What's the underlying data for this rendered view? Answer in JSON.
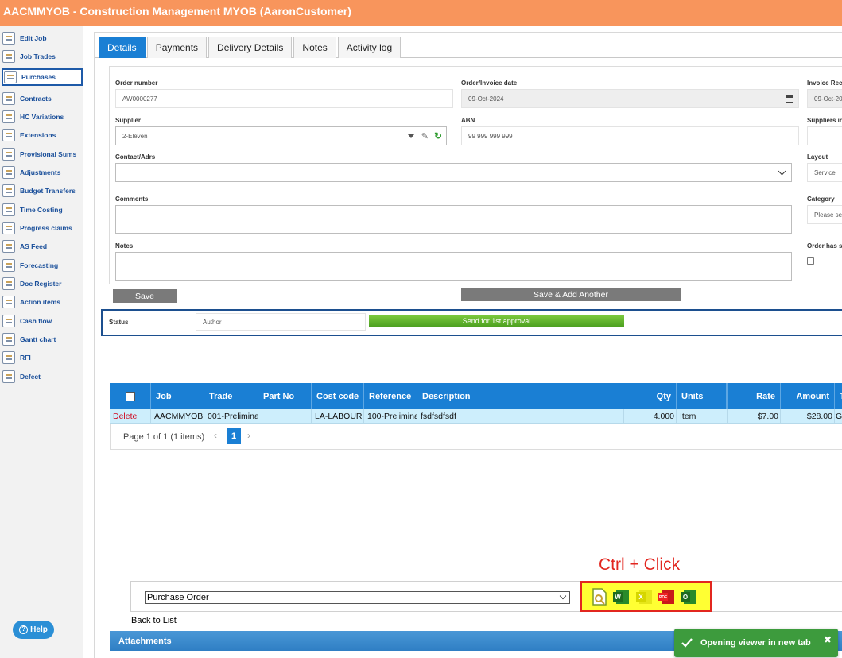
{
  "app": {
    "title": "AACMMYOB - Construction Management MYOB (AaronCustomer)"
  },
  "sidebar": {
    "items": [
      {
        "label": "Edit Job",
        "icon": "edit-icon"
      },
      {
        "label": "Job Trades",
        "icon": "folder-icon"
      },
      {
        "label": "Purchases",
        "icon": "purchases-icon",
        "active": true
      },
      {
        "label": "Contracts",
        "icon": "contract-icon"
      },
      {
        "label": "HC Variations",
        "icon": "variations-icon"
      },
      {
        "label": "Extensions",
        "icon": "extensions-icon"
      },
      {
        "label": "Provisional Sums",
        "icon": "provisional-sums-icon"
      },
      {
        "label": "Adjustments",
        "icon": "adjustments-icon"
      },
      {
        "label": "Budget Transfers",
        "icon": "budget-transfer-icon"
      },
      {
        "label": "Time Costing",
        "icon": "time-costing-icon"
      },
      {
        "label": "Progress claims",
        "icon": "progress-claims-icon"
      },
      {
        "label": "AS Feed",
        "icon": "feed-icon"
      },
      {
        "label": "Forecasting",
        "icon": "forecasting-icon"
      },
      {
        "label": "Doc Register",
        "icon": "doc-register-icon"
      },
      {
        "label": "Action items",
        "icon": "action-items-icon"
      },
      {
        "label": "Cash flow",
        "icon": "cash-flow-icon"
      },
      {
        "label": "Gantt chart",
        "icon": "gantt-icon"
      },
      {
        "label": "RFI",
        "icon": "rfi-icon"
      },
      {
        "label": "Defect",
        "icon": "defect-icon"
      }
    ],
    "help_label": "Help"
  },
  "tabs": [
    {
      "label": "Details",
      "active": true
    },
    {
      "label": "Payments"
    },
    {
      "label": "Delivery Details"
    },
    {
      "label": "Notes"
    },
    {
      "label": "Activity log"
    }
  ],
  "form": {
    "order_number_label": "Order number",
    "order_number_value": "AW0000277",
    "order_date_label": "Order/Invoice date",
    "order_date_value": "09-Oct-2024",
    "invoice_received_label": "Invoice Rece",
    "invoice_received_value": "09-Oct-20",
    "supplier_label": "Supplier",
    "supplier_value": "2-Eleven",
    "abn_label": "ABN",
    "abn_value": "99 999 999 999",
    "suppliers_inv_label": "Suppliers in",
    "contact_label": "Contact/Adrs",
    "layout_label": "Layout",
    "layout_value": "Service",
    "comments_label": "Comments",
    "category_label": "Category",
    "category_placeholder": "Please se",
    "notes_label": "Notes",
    "order_has_label": "Order has se",
    "save_label": "Save",
    "save_add_label": "Save & Add Another",
    "status_label": "Status",
    "status_value": "Author",
    "approve_label": "Send for 1st approval"
  },
  "grid": {
    "columns": [
      "Job",
      "Trade",
      "Part No",
      "Cost code",
      "Reference",
      "Description",
      "Qty",
      "Units",
      "Rate",
      "Amount",
      "T"
    ],
    "rows": [
      {
        "action": "Delete",
        "job": "AACMMYOB",
        "trade": "001-Prelimina",
        "part_no": "",
        "cost_code": "LA-LABOUR",
        "reference": "100-Prelimina",
        "description": "fsdfsdfsdf",
        "qty": "4.000",
        "units": "Item",
        "rate": "$7.00",
        "amount": "$28.00",
        "tax": "G"
      }
    ],
    "pager_text": "Page 1 of 1 (1 items)",
    "current_page": "1"
  },
  "print": {
    "hint": "Ctrl + Click",
    "document_type": "Purchase Order",
    "formats": [
      "view-icon",
      "word-icon",
      "excel-icon",
      "pdf-icon",
      "outlook-icon"
    ],
    "back_label": "Back to List"
  },
  "attachments_label": "Attachments",
  "toast": {
    "message": "Opening viewer in new tab"
  },
  "colors": {
    "header": "#f8955c",
    "accent": "#1a7fd4",
    "row_highlight": "#cdeefc",
    "toast": "#3d9b3d",
    "hint": "#e2261f"
  }
}
